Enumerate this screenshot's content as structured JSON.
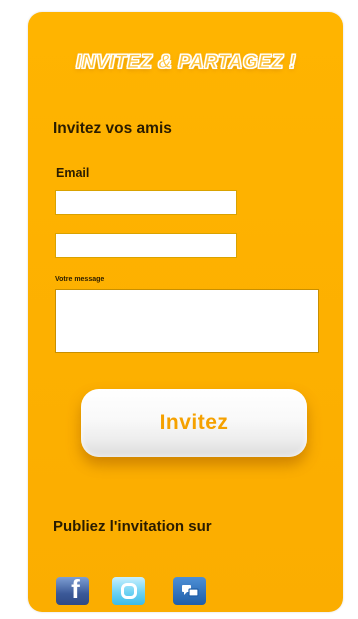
{
  "banner": {
    "title": "INVITEZ & PARTAGEZ !"
  },
  "invite_section": {
    "title": "Invitez vos amis",
    "email_label": "Email",
    "email_1_value": "",
    "email_2_value": "",
    "message_label": "Votre message",
    "message_value": "",
    "submit_label": "Invitez"
  },
  "share_section": {
    "title": "Publiez l'invitation sur",
    "networks": [
      {
        "name": "facebook-icon",
        "glyph": "f",
        "color": "#3b5998"
      },
      {
        "name": "twitter-icon",
        "glyph": "t",
        "color": "#3bbbe8"
      },
      {
        "name": "messenger-icon",
        "glyph": "",
        "color": "#1f5ea8"
      }
    ]
  },
  "colors": {
    "panel": "#ffb400",
    "button_text": "#f5a100",
    "text": "#2a1c00"
  }
}
